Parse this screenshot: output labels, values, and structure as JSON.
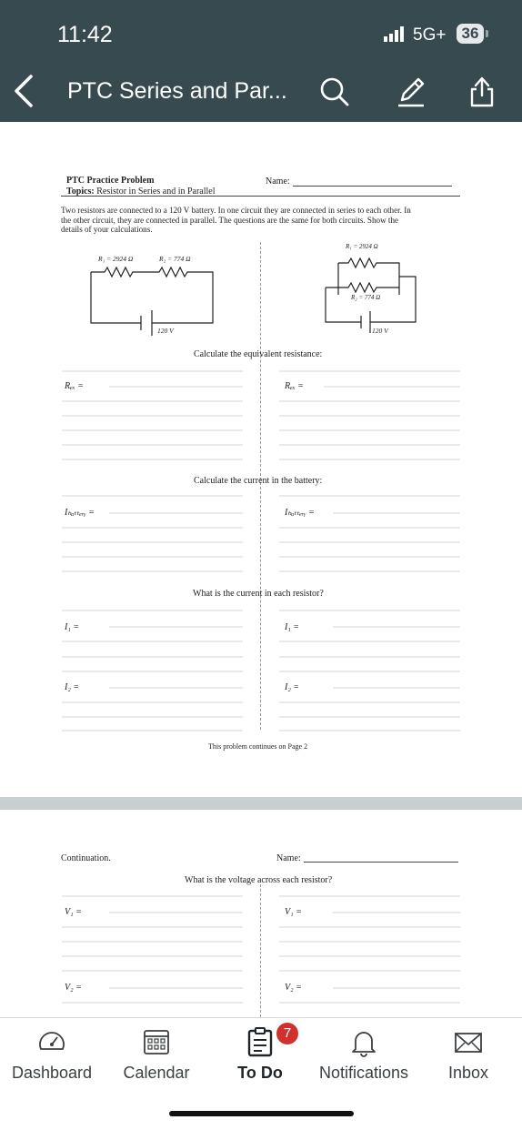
{
  "status": {
    "time": "11:42",
    "network": "5G+",
    "battery": "36"
  },
  "header": {
    "title": "PTC Series and Par..."
  },
  "page1": {
    "heading": "PTC Practice Problem",
    "topics_label": "Topics:",
    "topics": "Resistor in Series and in Parallel",
    "name_label": "Name:",
    "intro_line1": "Two resistors are connected to a 120 V battery. In one circuit they are connected in series to each other. In",
    "intro_line2": "the other circuit, they are connected in parallel. The questions are the same for both circuits. Show the",
    "intro_line3": "details of your calculations.",
    "r1_label": "R₁ = 2924 Ω",
    "r2_label": "R₂ = 774 Ω",
    "battery_label": "120 V",
    "q1": "Calculate the equivalent resistance:",
    "req": "Rₑₓ =",
    "q2": "Calculate the current in the battery:",
    "ibattery": "Iₕₐₜₜₑᵣᵧ =",
    "q3": "What is the current in each resistor?",
    "i1": "I₁ =",
    "i2": "I₂ =",
    "footer": "This problem continues on Page 2"
  },
  "page2": {
    "continuation": "Continuation.",
    "name_label": "Name:",
    "q4": "What is the voltage across each resistor?",
    "v1": "V₁ =",
    "v2": "V₂ ="
  },
  "tabs": [
    {
      "label": "Dashboard",
      "icon": "dashboard-icon"
    },
    {
      "label": "Calendar",
      "icon": "calendar-icon"
    },
    {
      "label": "To Do",
      "icon": "todo-icon"
    },
    {
      "label": "Notifications",
      "icon": "bell-icon"
    },
    {
      "label": "Inbox",
      "icon": "mail-icon"
    }
  ],
  "todo_badge": "7",
  "colors": {
    "topbar": "#374a4f",
    "badge": "#d0312d"
  }
}
